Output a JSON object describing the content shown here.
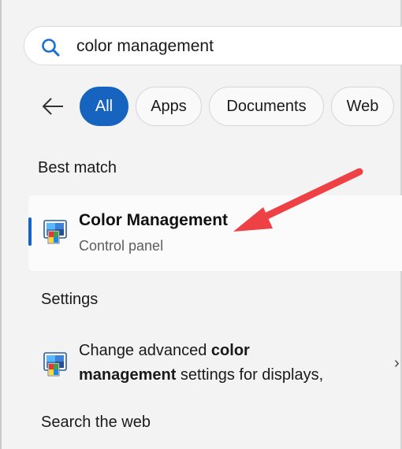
{
  "search": {
    "value": "color management",
    "icon": "search-icon"
  },
  "nav": {
    "back_icon": "back-arrow-icon"
  },
  "filters": [
    {
      "label": "All",
      "active": true
    },
    {
      "label": "Apps",
      "active": false
    },
    {
      "label": "Documents",
      "active": false
    },
    {
      "label": "Web",
      "active": false
    }
  ],
  "best_match": {
    "heading": "Best match",
    "title": "Color Management",
    "subtitle": "Control panel",
    "icon": "color-management-icon"
  },
  "settings": {
    "heading": "Settings",
    "item": {
      "text_pre": "Change advanced ",
      "text_bold1": "color",
      "text_bold2": "management",
      "text_post": " settings for displays,",
      "chevron": "›"
    }
  },
  "search_web": {
    "heading": "Search the web"
  },
  "colors": {
    "accent": "#1764c0",
    "annotation_arrow": "#ee4146"
  }
}
